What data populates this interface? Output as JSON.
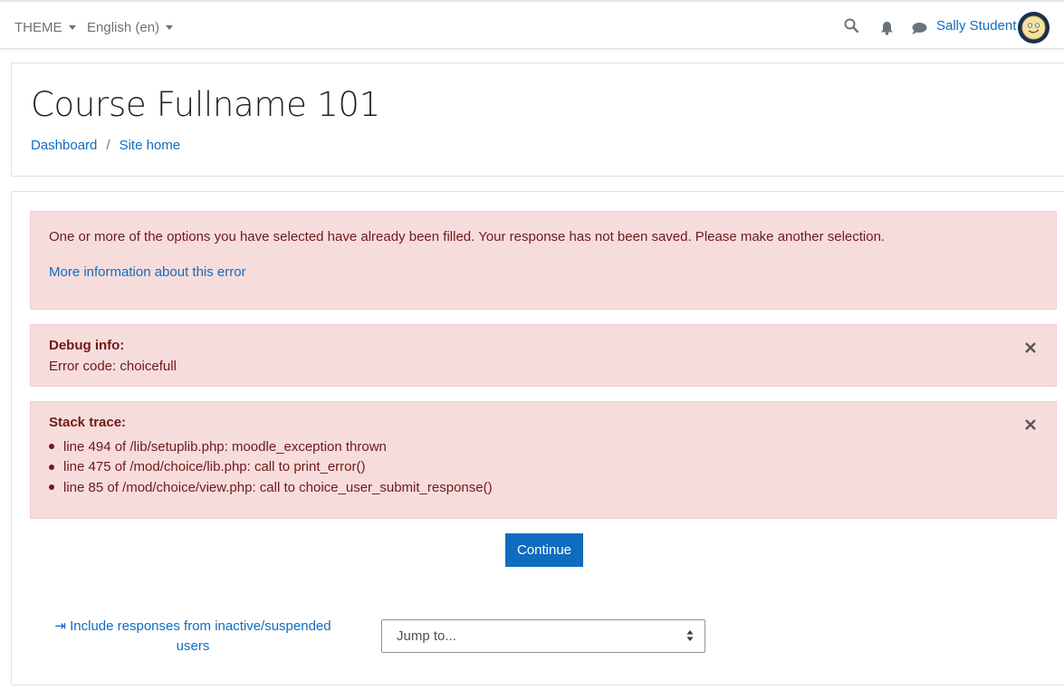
{
  "navbar": {
    "theme_label": "THEME",
    "language_label": "English (en)",
    "user_name": "Sally Student",
    "icons": [
      "search-icon",
      "bell-icon",
      "chat-icon",
      "avatar"
    ]
  },
  "header": {
    "title": "Course Fullname 101",
    "breadcrumb": [
      {
        "label": "Dashboard"
      },
      {
        "label": "Site home"
      }
    ],
    "breadcrumb_separator": "/"
  },
  "error": {
    "message": "One or more of the options you have selected have already been filled. Your response has not been saved. Please make another selection.",
    "more_info_link": "More information about this error"
  },
  "debug": {
    "heading": "Debug info:",
    "code_line": "Error code: choicefull"
  },
  "stack": {
    "heading": "Stack trace:",
    "lines": [
      "line 494 of /lib/setuplib.php: moodle_exception thrown",
      "line 475 of /mod/choice/lib.php: call to print_error()",
      "line 85 of /mod/choice/view.php: call to choice_user_submit_response()"
    ]
  },
  "actions": {
    "continue_label": "Continue",
    "include_responses_label": "Include responses from inactive/suspended users",
    "jump_to_placeholder": "Jump to..."
  },
  "colors": {
    "link": "#0f6cbf",
    "alert_bg": "#f7dcdc",
    "alert_text": "#6e1a1a",
    "button": "#0f6cbf"
  }
}
